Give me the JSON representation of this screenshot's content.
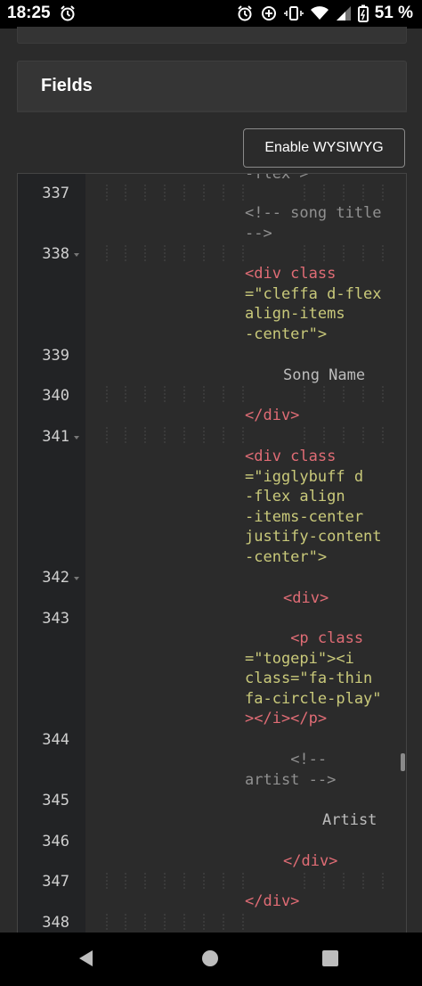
{
  "status_bar": {
    "time": "18:25",
    "battery": "51 %"
  },
  "fields_header": {
    "title": "Fields"
  },
  "toolbar": {
    "wysiwyg_label": "Enable WYSIWYG"
  },
  "editor": {
    "partial_top": "-flex\">",
    "line_numbers": [
      "337",
      "338",
      "339",
      "340",
      "341",
      "342",
      "343",
      "344",
      "345",
      "346",
      "347",
      "348"
    ],
    "lines": {
      "l337": [
        "<!-- song title",
        "-->"
      ],
      "l338": [
        "<div class",
        "=\"cleffa d-flex",
        "align-items",
        "-center\">"
      ],
      "l339": "Song Name",
      "l340": "</div>",
      "l341": [
        "<div class",
        "=\"igglybuff d",
        "-flex align",
        "-items-center",
        "justify-content",
        "-center\">"
      ],
      "l342": "<div>",
      "l343": [
        "<p class",
        "=\"togepi\"><i",
        "class=\"fa-thin",
        "fa-circle-play\"",
        "></i></p>"
      ],
      "l344": [
        "<!--",
        "artist -->"
      ],
      "l345": "Artist",
      "l346": "</div>",
      "l347": "</div>"
    }
  },
  "colors": {
    "background": "#2b2b2b",
    "gutter": "#222325",
    "tag": "#e06c75",
    "string": "#c9c97a",
    "comment": "#909090"
  }
}
